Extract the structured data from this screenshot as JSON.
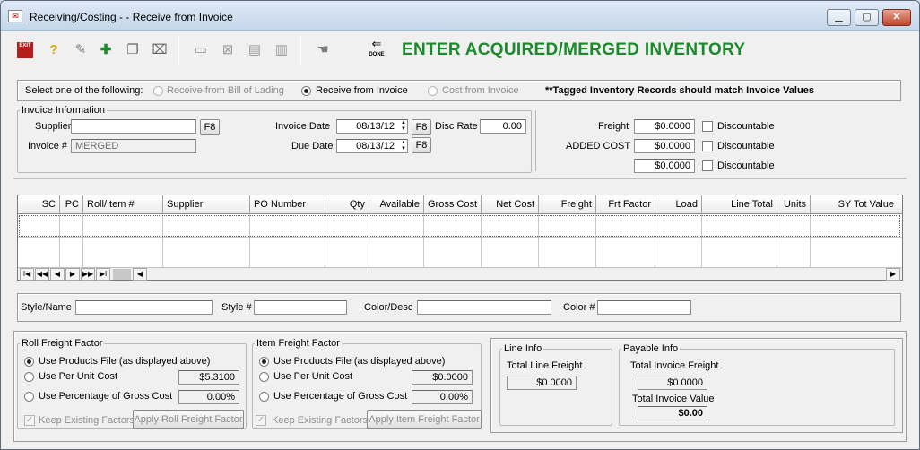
{
  "window": {
    "title": "Receiving/Costing - - Receive from Invoice",
    "minimize_label": "▁",
    "maximize_label": "▢",
    "close_label": "✕"
  },
  "toolbar": {
    "exit_label": "EXIT",
    "done_label": "DONE",
    "banner": "ENTER ACQUIRED/MERGED INVENTORY",
    "icons": [
      "exit-icon",
      "help-icon",
      "wrench-icon",
      "add-icon",
      "copy-icon",
      "delete-icon",
      "tag-icon-1",
      "tag-icon-2",
      "tag-icon-3",
      "tag-icon-4",
      "hand-icon",
      "done-icon"
    ]
  },
  "source_select": {
    "prompt": "Select one of the following:",
    "options": [
      {
        "label": "Receive from Bill of Lading",
        "selected": false,
        "enabled": false
      },
      {
        "label": "Receive from Invoice",
        "selected": true,
        "enabled": true
      },
      {
        "label": "Cost from Invoice",
        "selected": false,
        "enabled": false
      }
    ],
    "note": "**Tagged Inventory Records should match Invoice Values"
  },
  "invoice": {
    "legend": "Invoice Information",
    "supplier_label": "Supplier",
    "supplier_value": "",
    "invoice_no_label": "Invoice #",
    "invoice_no_value": "MERGED",
    "f8_label": "F8",
    "invoice_date_label": "Invoice Date",
    "invoice_date_value": "08/13/12",
    "due_date_label": "Due Date",
    "due_date_value": "08/13/12",
    "disc_rate_label": "Disc Rate",
    "disc_rate_value": "0.00"
  },
  "charges": {
    "freight_label": "Freight",
    "freight_value": "$0.0000",
    "added_cost_label": "ADDED COST",
    "added_cost_value": "$0.0000",
    "other_value": "$0.0000",
    "discountable_label": "Discountable"
  },
  "grid": {
    "columns": [
      "SC",
      "PC",
      "Roll/Item #",
      "Supplier",
      "PO Number",
      "Qty",
      "Available",
      "Gross Cost",
      "Net Cost",
      "Freight",
      "Frt Factor",
      "Load",
      "Line Total",
      "Units",
      "SY Tot Value"
    ],
    "nav_buttons": [
      "I◀",
      "◀◀",
      "◀",
      "▶",
      "▶▶",
      "▶I"
    ],
    "scroll_left": "◀",
    "scroll_right": "▶"
  },
  "style_bar": {
    "style_name_label": "Style/Name",
    "style_name_value": "",
    "style_no_label": "Style #",
    "style_no_value": "",
    "color_desc_label": "Color/Desc",
    "color_desc_value": "",
    "color_no_label": "Color #",
    "color_no_value": ""
  },
  "roll_freight": {
    "legend": "Roll Freight Factor",
    "opt_products": "Use Products File (as displayed above)",
    "opt_per_unit": "Use Per Unit Cost",
    "per_unit_value": "$5.3100",
    "opt_percentage": "Use Percentage of Gross Cost",
    "percentage_value": "0.00%",
    "keep_label": "Keep Existing Factors",
    "apply_label": "Apply Roll Freight Factor"
  },
  "item_freight": {
    "legend": "Item Freight Factor",
    "opt_products": "Use Products File (as displayed above)",
    "opt_per_unit": "Use Per Unit Cost",
    "per_unit_value": "$0.0000",
    "opt_percentage": "Use Percentage of Gross Cost",
    "percentage_value": "0.00%",
    "keep_label": "Keep Existing Factors",
    "apply_label": "Apply Item Freight Factor"
  },
  "line_info": {
    "legend": "Line Info",
    "total_line_freight_label": "Total Line Freight",
    "total_line_freight_value": "$0.0000"
  },
  "payable_info": {
    "legend": "Payable Info",
    "total_invoice_freight_label": "Total Invoice Freight",
    "total_invoice_freight_value": "$0.0000",
    "total_invoice_value_label": "Total Invoice Value",
    "total_invoice_value_value": "$0.00"
  },
  "colors": {
    "banner": "#1b8a2a",
    "close_button": "#c0462c"
  }
}
